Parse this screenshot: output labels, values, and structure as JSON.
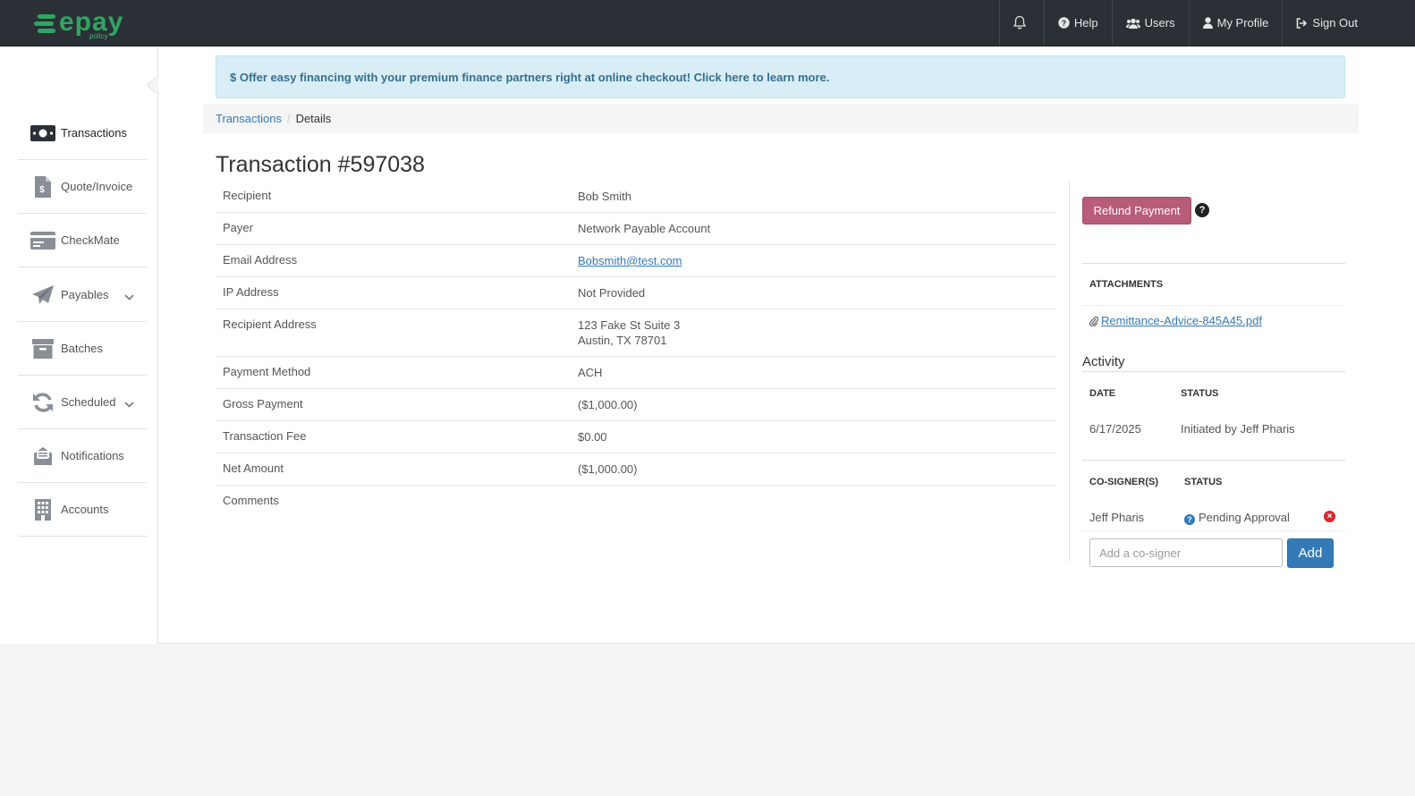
{
  "brand": {
    "name": "epay",
    "sub": "policy",
    "color": "#2fa562"
  },
  "topnav": {
    "items": [
      {
        "label": "",
        "icon": "bell-icon"
      },
      {
        "label": "Help",
        "icon": "help-circle-icon"
      },
      {
        "label": "Users",
        "icon": "users-icon"
      },
      {
        "label": "My Profile",
        "icon": "user-icon"
      },
      {
        "label": "Sign Out",
        "icon": "sign-out-icon"
      }
    ]
  },
  "sidebar": {
    "items": [
      {
        "label": "Transactions",
        "icon": "money-icon",
        "active": true
      },
      {
        "label": "Quote/Invoice",
        "icon": "invoice-icon"
      },
      {
        "label": "CheckMate",
        "icon": "check-card-icon"
      },
      {
        "label": "Payables",
        "icon": "paper-plane-icon",
        "expandable": true
      },
      {
        "label": "Batches",
        "icon": "archive-icon"
      },
      {
        "label": "Scheduled",
        "icon": "refresh-icon",
        "expandable": true
      },
      {
        "label": "Notifications",
        "icon": "envelope-icon"
      },
      {
        "label": "Accounts",
        "icon": "building-icon"
      }
    ]
  },
  "banner": {
    "text": "$ Offer easy financing with your premium finance partners right at online checkout! Click here to learn more."
  },
  "breadcrumb": {
    "parent": "Transactions",
    "separator": "/",
    "current": "Details"
  },
  "page": {
    "title": "Transaction #597038"
  },
  "details": {
    "rows": [
      {
        "label": "Recipient",
        "value": "Bob Smith"
      },
      {
        "label": "Payer",
        "value": "Network Payable Account"
      },
      {
        "label": "Email Address",
        "value": "Bobsmith@test.com",
        "link": true
      },
      {
        "label": "IP Address",
        "value": "Not Provided"
      },
      {
        "label": "Recipient Address",
        "value": "123 Fake St Suite 3",
        "value2": "Austin, TX 78701"
      },
      {
        "label": "Payment Method",
        "value": "ACH"
      },
      {
        "label": "Gross Payment",
        "value": "($1,000.00)"
      },
      {
        "label": "Transaction Fee",
        "value": "$0.00"
      },
      {
        "label": "Net Amount",
        "value": "($1,000.00)"
      },
      {
        "label": "Comments",
        "value": ""
      }
    ]
  },
  "actions": {
    "refund_label": "Refund Payment",
    "refund_color": "#b85c7a",
    "help": "?"
  },
  "attachments": {
    "heading": "ATTACHMENTS",
    "file": "Remittance-Advice-845A45.pdf"
  },
  "activity": {
    "title": "Activity",
    "headers": {
      "date": "DATE",
      "status": "STATUS"
    },
    "rows": [
      {
        "date": "6/17/2025",
        "status": "Initiated by Jeff Pharis"
      }
    ]
  },
  "cosigners": {
    "headers": {
      "name": "CO-SIGNER(S)",
      "status": "STATUS"
    },
    "rows": [
      {
        "name": "Jeff Pharis",
        "status": "Pending Approval"
      }
    ],
    "input_placeholder": "Add a co-signer",
    "add_label": "Add"
  }
}
